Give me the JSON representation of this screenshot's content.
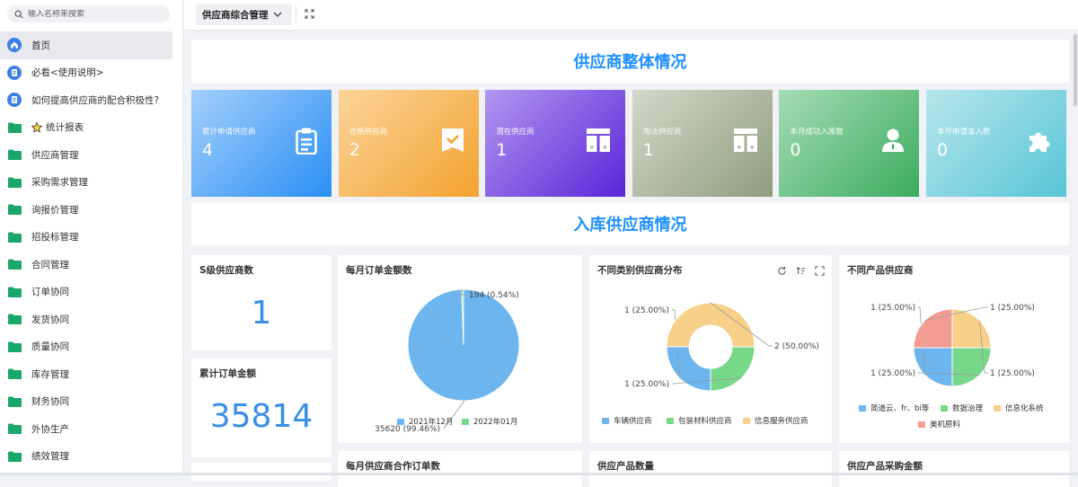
{
  "sidebar": {
    "search_placeholder": "输入名称来搜索",
    "items": [
      {
        "label": "首页",
        "icon": "home-icon"
      },
      {
        "label": "必看<使用说明>",
        "icon": "document-icon"
      },
      {
        "label": "如何提高供应商的配合积极性?",
        "icon": "document-icon"
      },
      {
        "label": "统计报表",
        "icon": "folder-icon",
        "star": true
      },
      {
        "label": "供应商管理",
        "icon": "folder-icon"
      },
      {
        "label": "采购需求管理",
        "icon": "folder-icon"
      },
      {
        "label": "询报价管理",
        "icon": "folder-icon"
      },
      {
        "label": "招投标管理",
        "icon": "folder-icon"
      },
      {
        "label": "合同管理",
        "icon": "folder-icon"
      },
      {
        "label": "订单协同",
        "icon": "folder-icon"
      },
      {
        "label": "发货协同",
        "icon": "folder-icon"
      },
      {
        "label": "质量协同",
        "icon": "folder-icon"
      },
      {
        "label": "库存管理",
        "icon": "folder-icon"
      },
      {
        "label": "财务协同",
        "icon": "folder-icon"
      },
      {
        "label": "外协生产",
        "icon": "folder-icon"
      },
      {
        "label": "绩效管理",
        "icon": "folder-icon"
      }
    ]
  },
  "topbar": {
    "selector_label": "供应商综合管理"
  },
  "section1": {
    "title": "供应商整体情况"
  },
  "section2": {
    "title": "入库供应商情况"
  },
  "cards": [
    {
      "label": "累计申请供应商",
      "value": "4",
      "icon": "clipboard-icon",
      "from": "#a3cffb",
      "to": "#2a8ff5"
    },
    {
      "label": "合格供应商",
      "value": "2",
      "icon": "check-bookmark-icon",
      "from": "#fbd49a",
      "to": "#f3a22e"
    },
    {
      "label": "潜在供应商",
      "value": "1",
      "icon": "columns-icon",
      "from": "#b396f0",
      "to": "#5a25d8"
    },
    {
      "label": "淘汰供应商",
      "value": "1",
      "icon": "columns-icon",
      "from": "#d3d8c8",
      "to": "#8e9d7f"
    },
    {
      "label": "本月成功入库数",
      "value": "0",
      "icon": "user-icon",
      "from": "#a5dcb5",
      "to": "#3bac5e"
    },
    {
      "label": "本月申请准入数",
      "value": "0",
      "icon": "puzzle-icon",
      "from": "#b6e6ec",
      "to": "#57c5d6"
    }
  ],
  "panels": {
    "s_level": {
      "title": "S级供应商数",
      "value": "1"
    },
    "total_order": {
      "title": "累计订单金额",
      "value": "35814"
    },
    "monthly_amount": {
      "title": "每月订单金额数"
    },
    "category": {
      "title": "不同类别供应商分布"
    },
    "product": {
      "title": "不同产品供应商"
    },
    "monthly_cooperation": {
      "title": "每月供应商合作订单数"
    },
    "product_count": {
      "title": "供应产品数量"
    },
    "product_purchase": {
      "title": "供应产品采购金额"
    }
  },
  "chart_data": [
    {
      "type": "pie",
      "title": "每月订单金额数",
      "categories": [
        "2021年12月",
        "2022年01月"
      ],
      "values": [
        35620,
        194
      ],
      "labels": [
        "35620 (99.46%)",
        "194 (0.54%)"
      ],
      "colors": [
        "#6cb5ee",
        "#78d889"
      ],
      "legend": "bottom"
    },
    {
      "type": "pie",
      "subtype": "donut",
      "title": "不同类别供应商分布",
      "categories": [
        "车辆供应商",
        "包装材料供应商",
        "信息服务供应商"
      ],
      "values": [
        1,
        1,
        2
      ],
      "labels": [
        "1 (25.00%)",
        "1 (25.00%)",
        "2 (50.00%)"
      ],
      "colors": [
        "#6cb5ee",
        "#78d889",
        "#f8d08a"
      ],
      "legend": "bottom"
    },
    {
      "type": "pie",
      "title": "不同产品供应商",
      "categories": [
        "简道云、fr、bi等",
        "数据治理",
        "信息化系统",
        "美机原料"
      ],
      "values": [
        1,
        1,
        1,
        1
      ],
      "labels": [
        "1 (25.00%)",
        "1 (25.00%)",
        "1 (25.00%)",
        "1 (25.00%)"
      ],
      "colors": [
        "#6cb5ee",
        "#78d889",
        "#f8d08a",
        "#f49c92"
      ],
      "legend": "bottom"
    }
  ]
}
